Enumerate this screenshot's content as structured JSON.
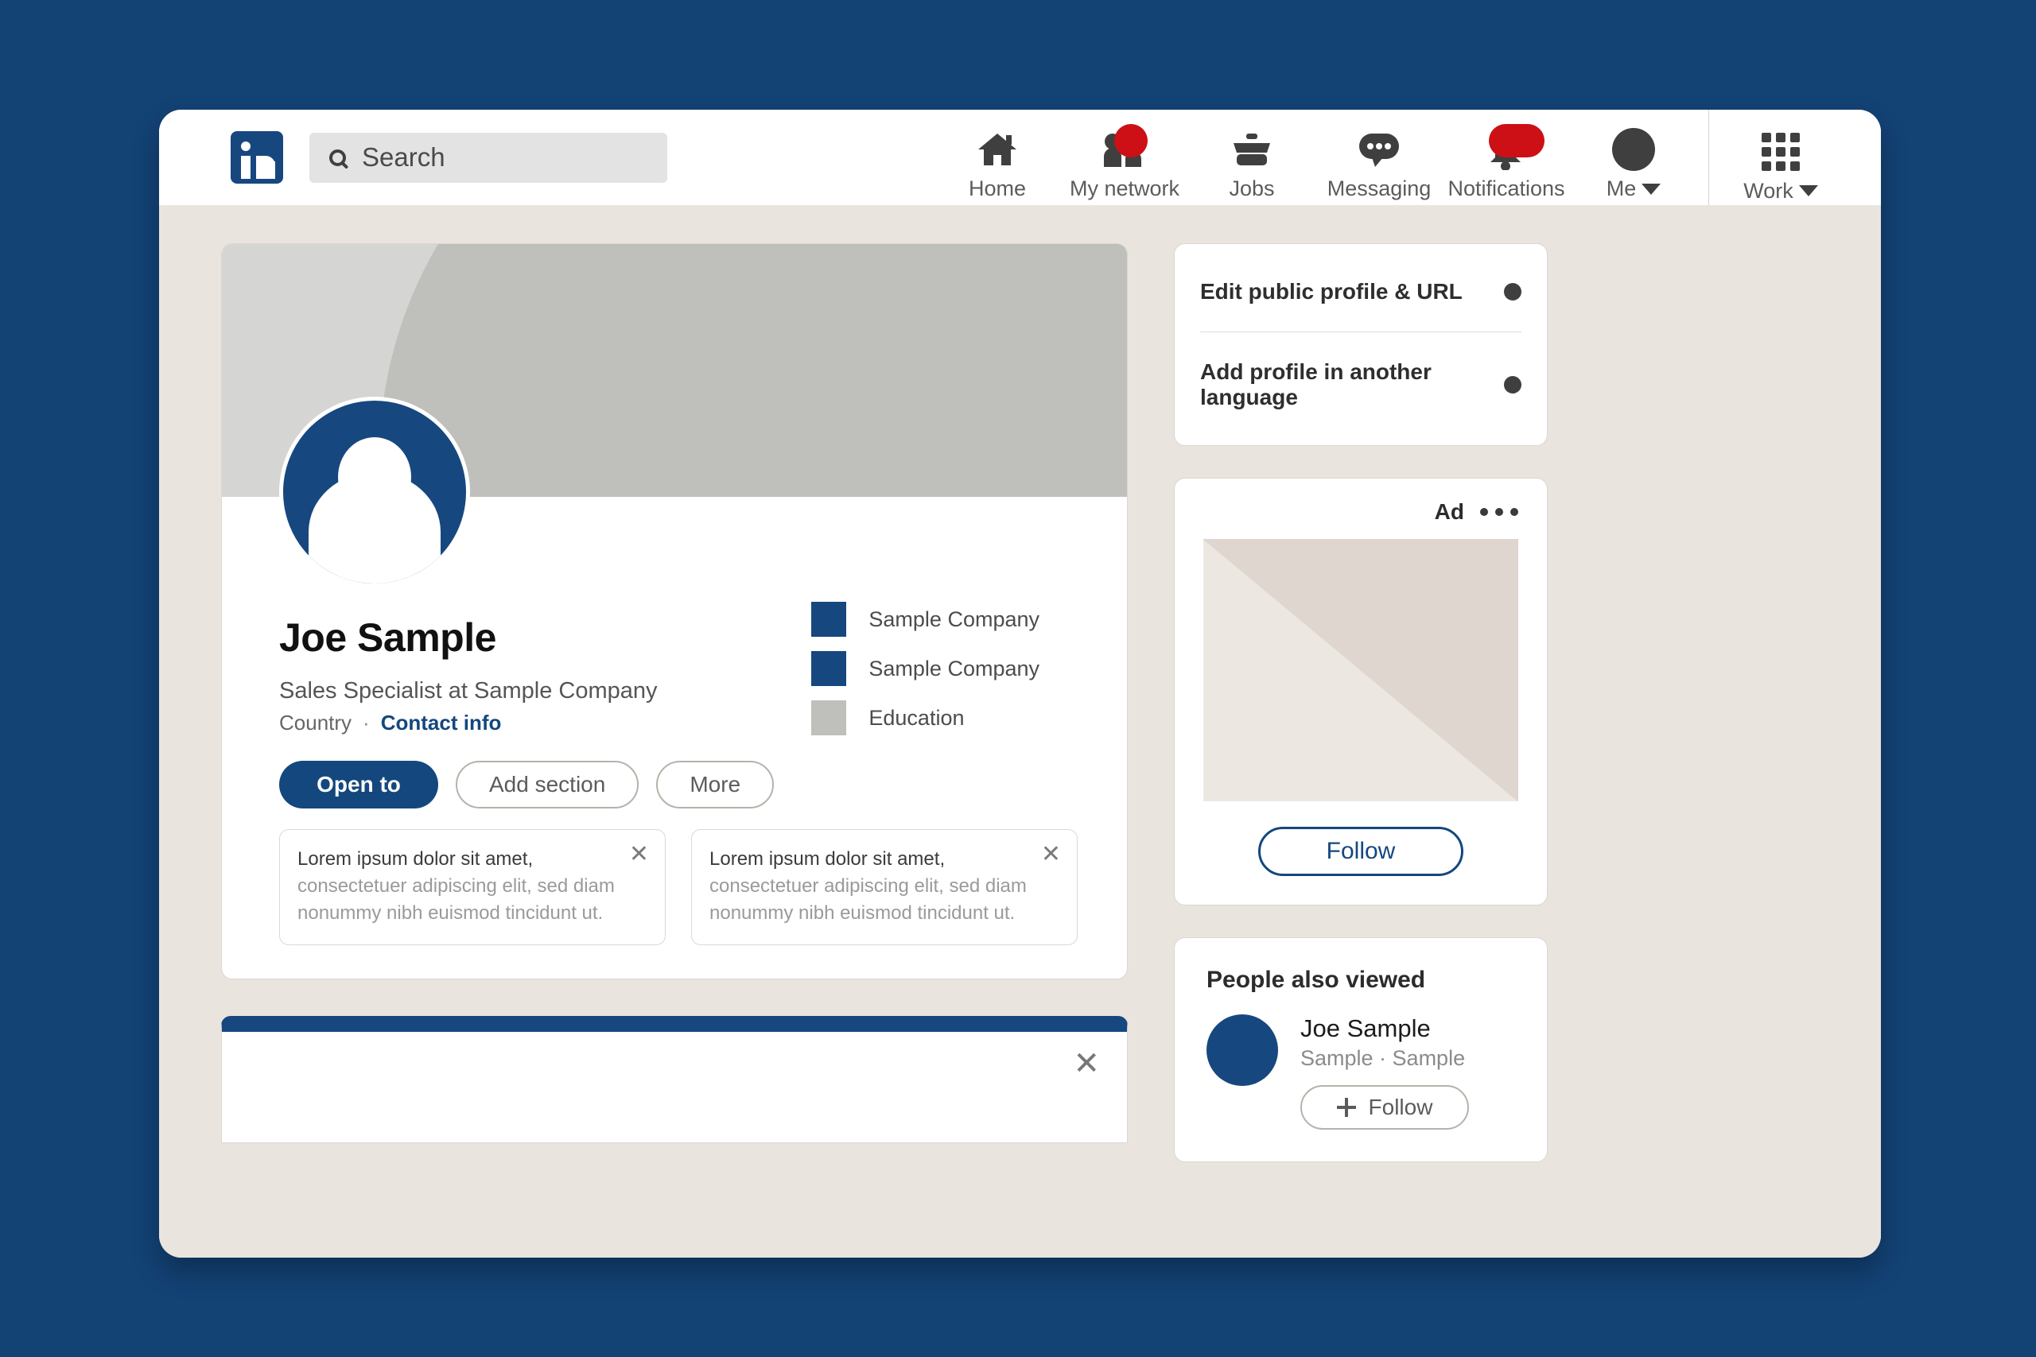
{
  "nav": {
    "logo_icon": "linkedin-logo-icon",
    "search": {
      "icon": "search-icon",
      "placeholder": "Search",
      "value": ""
    },
    "items": [
      {
        "label": "Home",
        "icon": "home-icon",
        "badge": false
      },
      {
        "label": "My network",
        "icon": "people-icon",
        "badge": true
      },
      {
        "label": "Jobs",
        "icon": "briefcase-icon",
        "badge": false
      },
      {
        "label": "Messaging",
        "icon": "message-bubble-icon",
        "badge": false
      },
      {
        "label": "Notifications",
        "icon": "bell-icon",
        "badge": true
      },
      {
        "label": "Me",
        "icon": "avatar-icon",
        "badge": false,
        "has_caret": true
      }
    ],
    "work": {
      "label": "Work",
      "icon": "grid-apps-icon",
      "has_caret": true
    }
  },
  "profile": {
    "cover_icon": "cover-photo",
    "avatar_icon": "default-avatar-icon",
    "name": "Joe Sample",
    "headline": "Sales Specialist at Sample Company",
    "location": "Country",
    "separator": "·",
    "contact_info": "Contact info",
    "actions": [
      {
        "label": "Open to",
        "style": "primary"
      },
      {
        "label": "Add section",
        "style": "outline"
      },
      {
        "label": "More",
        "style": "outline"
      }
    ],
    "legend": [
      {
        "label": "Sample Company",
        "color": "#17477f"
      },
      {
        "label": "Sample Company",
        "color": "#17477f"
      },
      {
        "label": "Education",
        "color": "#bfbfbb"
      }
    ],
    "lorem_cards": [
      {
        "lead": "Lorem ipsum dolor sit amet,",
        "rest": " consectetuer adipiscing elit, sed diam nonummy nibh euismod tincidunt ut.",
        "close_icon": "close-icon"
      },
      {
        "lead": "Lorem ipsum dolor sit amet,",
        "rest": " consectetuer adipiscing elit, sed diam nonummy nibh euismod tincidunt ut.",
        "close_icon": "close-icon"
      }
    ]
  },
  "bottom_card": {
    "close_icon": "close-icon",
    "accent_color": "#17477f"
  },
  "sidebar": {
    "edit_links": [
      {
        "label": "Edit public profile & URL",
        "bullet_icon": "bullet-icon"
      },
      {
        "label": "Add profile in another language",
        "bullet_icon": "bullet-icon"
      }
    ],
    "ad": {
      "label": "Ad",
      "menu_icon": "more-options-icon",
      "image_icon": "ad-image-placeholder",
      "follow_label": "Follow"
    },
    "people_also_viewed": {
      "title": "People also viewed",
      "items": [
        {
          "avatar_icon": "avatar-icon",
          "name": "Joe Sample",
          "subtitle": "Sample · Sample",
          "follow_label": "Follow",
          "follow_icon": "plus-icon"
        }
      ]
    }
  },
  "colors": {
    "page_background": "#134275",
    "linkedin_blue": "#17477f",
    "accent_link": "#14477e",
    "badge_red": "#cc1016",
    "content_background": "#e9e4de",
    "cover_gray": "#d5d5d3",
    "cover_gray_dark": "#bfbfbb"
  }
}
